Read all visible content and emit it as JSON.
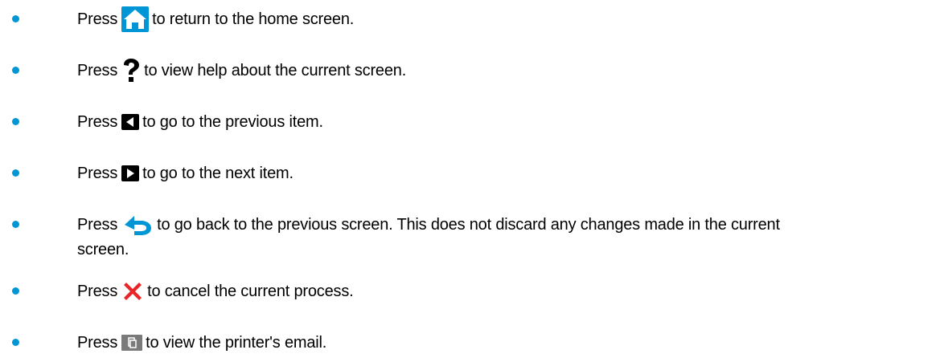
{
  "bullet_color": "#0096d6",
  "items": [
    {
      "press": "Press",
      "icon": "home-icon",
      "icon_color": "#0096d6",
      "text": "to return to the home screen."
    },
    {
      "press": "Press",
      "icon": "help-icon",
      "icon_color": "#000000",
      "text": "to view help about the current screen."
    },
    {
      "press": "Press",
      "icon": "left-arrow-icon",
      "icon_color": "#000000",
      "text": "to go to the previous item."
    },
    {
      "press": "Press",
      "icon": "right-arrow-icon",
      "icon_color": "#000000",
      "text": "to go to the next item."
    },
    {
      "press": "Press",
      "icon": "back-icon",
      "icon_color": "#0096d6",
      "text": "to go back to the previous screen. This does not discard any changes made in the current",
      "continuation": "screen."
    },
    {
      "press": "Press",
      "icon": "cancel-icon",
      "icon_color": "#e8262a",
      "text": "to cancel the current process."
    },
    {
      "press": "Press",
      "icon": "eprint-icon",
      "icon_color": "#7a7a7a",
      "text": "to view the printer's email."
    }
  ]
}
